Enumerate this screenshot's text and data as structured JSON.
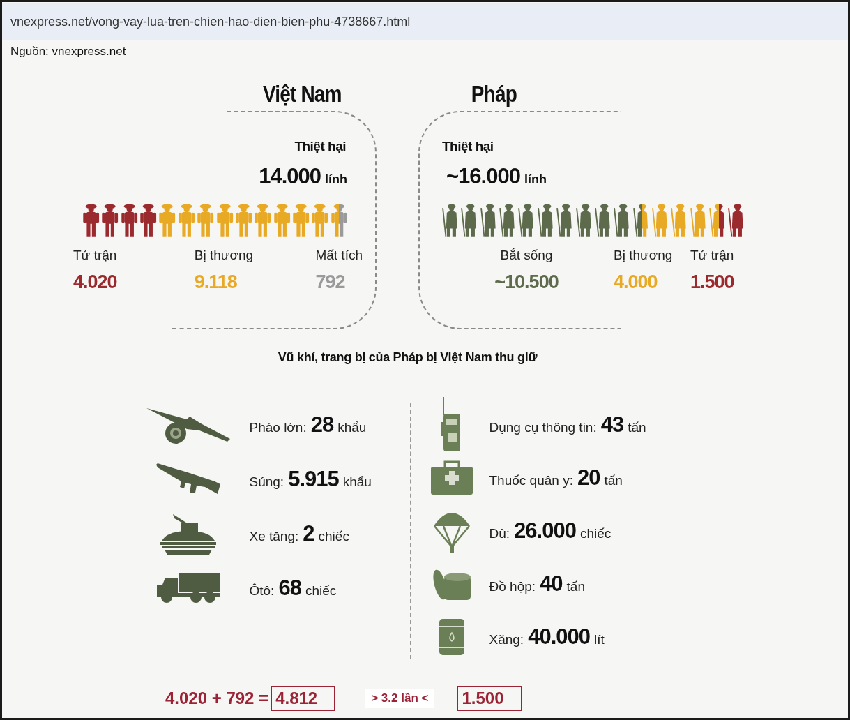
{
  "address_bar": {
    "url": "vnexpress.net/vong-vay-lua-tren-chien-hao-dien-bien-phu-4738667.html"
  },
  "source": "Nguồn: vnexpress.net",
  "sides": [
    {
      "title": "Việt Nam",
      "kind": "vietnam",
      "loss_label": "Thiệt hại",
      "loss_value": "14.000",
      "loss_unit": "lính",
      "figures": [
        {
          "kind": "whole",
          "color": "#9b2a2e"
        },
        {
          "kind": "whole",
          "color": "#9b2a2e"
        },
        {
          "kind": "whole",
          "color": "#9b2a2e"
        },
        {
          "kind": "whole",
          "color": "#9b2a2e"
        },
        {
          "kind": "whole",
          "color": "#e8a925"
        },
        {
          "kind": "whole",
          "color": "#e8a925"
        },
        {
          "kind": "whole",
          "color": "#e8a925"
        },
        {
          "kind": "whole",
          "color": "#e8a925"
        },
        {
          "kind": "whole",
          "color": "#e8a925"
        },
        {
          "kind": "whole",
          "color": "#e8a925"
        },
        {
          "kind": "whole",
          "color": "#e8a925"
        },
        {
          "kind": "whole",
          "color": "#e8a925"
        },
        {
          "kind": "whole",
          "color": "#e8a925"
        },
        {
          "kind": "left-half",
          "color": "#e8a925"
        },
        {
          "kind": "right-half",
          "color": "#9a9a9a"
        }
      ],
      "stats": [
        {
          "label": "Tử trận",
          "value": "4.020",
          "color": "#9b2a2e"
        },
        {
          "label": "Bị thương",
          "value": "9.118",
          "color": "#e8a925"
        },
        {
          "label": "Mất tích",
          "value": "792",
          "color": "#9a9a9a"
        }
      ]
    },
    {
      "title": "Pháp",
      "kind": "france",
      "loss_label": "Thiệt hại",
      "loss_value": "~16.000",
      "loss_unit": "lính",
      "figures": [
        {
          "kind": "whole",
          "color": "#5d6b4c"
        },
        {
          "kind": "whole",
          "color": "#5d6b4c"
        },
        {
          "kind": "whole",
          "color": "#5d6b4c"
        },
        {
          "kind": "whole",
          "color": "#5d6b4c"
        },
        {
          "kind": "whole",
          "color": "#5d6b4c"
        },
        {
          "kind": "whole",
          "color": "#5d6b4c"
        },
        {
          "kind": "whole",
          "color": "#5d6b4c"
        },
        {
          "kind": "whole",
          "color": "#5d6b4c"
        },
        {
          "kind": "whole",
          "color": "#5d6b4c"
        },
        {
          "kind": "whole",
          "color": "#5d6b4c"
        },
        {
          "kind": "left-half",
          "color": "#5d6b4c"
        },
        {
          "kind": "right-half",
          "color": "#e8a925"
        },
        {
          "kind": "whole",
          "color": "#e8a925"
        },
        {
          "kind": "whole",
          "color": "#e8a925"
        },
        {
          "kind": "whole",
          "color": "#e8a925"
        },
        {
          "kind": "left-half",
          "color": "#e8a925"
        },
        {
          "kind": "right-half",
          "color": "#9b2a2e"
        },
        {
          "kind": "whole",
          "color": "#9b2a2e"
        }
      ],
      "stats": [
        {
          "label": "Bắt sống",
          "value": "~10.500",
          "color": "#5d6b4c"
        },
        {
          "label": "Bị thương",
          "value": "4.000",
          "color": "#e8a925"
        },
        {
          "label": "Tử trận",
          "value": "1.500",
          "color": "#9b2a2e"
        }
      ]
    }
  ],
  "captured": {
    "title": "Vũ khí, trang bị của Pháp bị Việt Nam thu giữ",
    "columns": [
      [
        {
          "kind": "cannon",
          "label": "Pháo lớn:",
          "value": "28",
          "unit": "khẩu"
        },
        {
          "kind": "rifle",
          "label": "Súng:",
          "value": "5.915",
          "unit": "khẩu"
        },
        {
          "kind": "tank",
          "label": "Xe tăng:",
          "value": "2",
          "unit": "chiếc"
        },
        {
          "kind": "truck",
          "label": "Ôtô:",
          "value": "68",
          "unit": "chiếc"
        }
      ],
      [
        {
          "kind": "radio",
          "label": "Dụng cụ thông tin:",
          "value": "43",
          "unit": "tấn"
        },
        {
          "kind": "medkit",
          "label": "Thuốc quân y:",
          "value": "20",
          "unit": "tấn"
        },
        {
          "kind": "parachute",
          "label": "Dù:",
          "value": "26.000",
          "unit": "chiếc"
        },
        {
          "kind": "can",
          "label": "Đồ hộp:",
          "value": "40",
          "unit": "tấn"
        },
        {
          "kind": "barrel",
          "label": "Xăng:",
          "value": "40.000",
          "unit": "lít"
        }
      ]
    ]
  },
  "summary": {
    "sum": "4.020 + 792 =",
    "total": "4.812",
    "ratio": "> 3.2 lần <",
    "compare": "1.500"
  }
}
